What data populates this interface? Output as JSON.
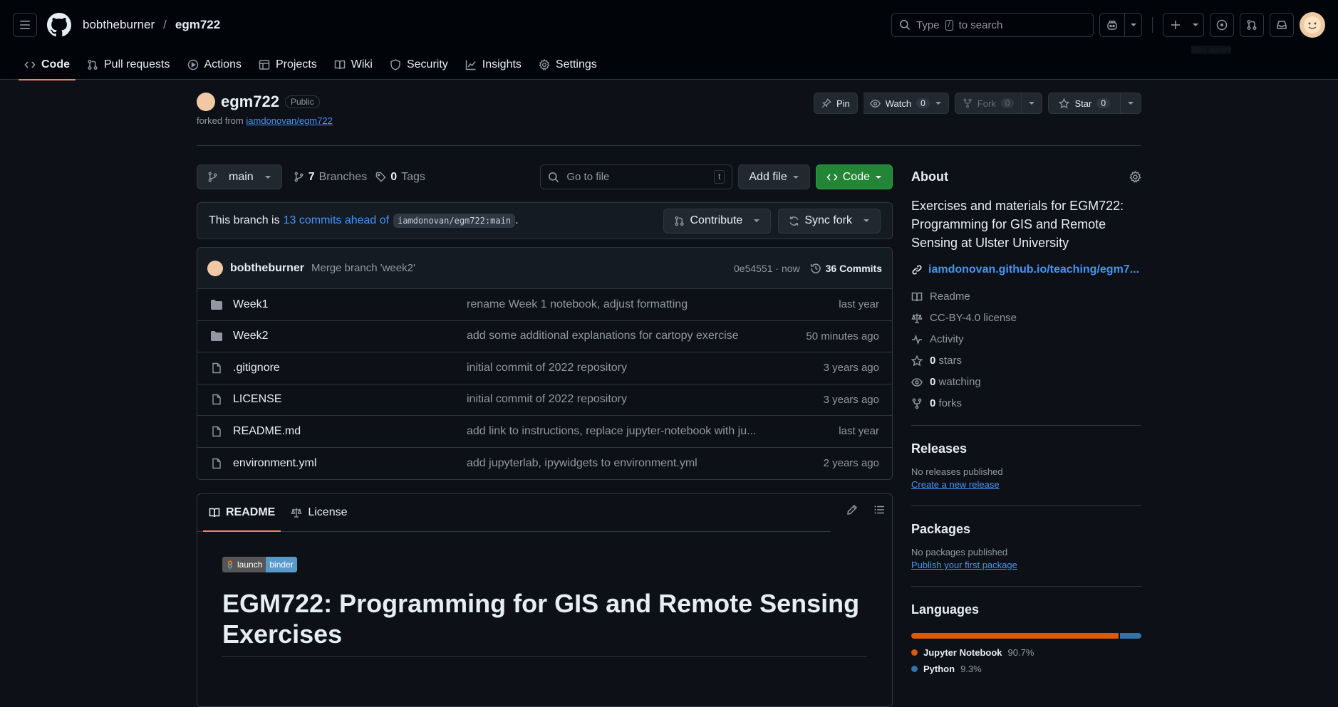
{
  "header": {
    "owner": "bobtheburner",
    "separator": "/",
    "repo": "egm722",
    "search_placeholder_prefix": "Type",
    "search_key": "/",
    "search_placeholder_suffix": "to search",
    "tooltip": "Your issues"
  },
  "nav_tabs": [
    {
      "label": "Code",
      "icon": "code-icon"
    },
    {
      "label": "Pull requests",
      "icon": "git-pull-request-icon"
    },
    {
      "label": "Actions",
      "icon": "play-icon"
    },
    {
      "label": "Projects",
      "icon": "table-icon"
    },
    {
      "label": "Wiki",
      "icon": "book-icon"
    },
    {
      "label": "Security",
      "icon": "shield-icon"
    },
    {
      "label": "Insights",
      "icon": "graph-icon"
    },
    {
      "label": "Settings",
      "icon": "gear-icon"
    }
  ],
  "repo_header": {
    "name": "egm722",
    "visibility": "Public",
    "forked_prefix": "forked from",
    "forked_from": "iamdonovan/egm722",
    "pin_label": "Pin",
    "watch_label": "Watch",
    "watch_count": "0",
    "fork_label": "Fork",
    "fork_count": "0",
    "star_label": "Star",
    "star_count": "0"
  },
  "toolbar": {
    "branch": "main",
    "branches_count": "7",
    "branches_label": "Branches",
    "tags_count": "0",
    "tags_label": "Tags",
    "goto_placeholder": "Go to file",
    "goto_key": "t",
    "add_file_label": "Add file",
    "code_label": "Code"
  },
  "ahead_banner": {
    "prefix": "This branch is",
    "link": "13 commits ahead of",
    "ref": "iamdonovan/egm722:main",
    "suffix": ".",
    "contribute_label": "Contribute",
    "sync_label": "Sync fork"
  },
  "latest_commit": {
    "author": "bobtheburner",
    "message": "Merge branch 'week2'",
    "hash_time": "0e54551 · now",
    "commits_label": "36 Commits"
  },
  "files": [
    {
      "type": "folder",
      "name": "Week1",
      "message": "rename Week 1 notebook, adjust formatting",
      "date": "last year"
    },
    {
      "type": "folder",
      "name": "Week2",
      "message": "add some additional explanations for cartopy exercise",
      "date": "50 minutes ago"
    },
    {
      "type": "file",
      "name": ".gitignore",
      "message": "initial commit of 2022 repository",
      "date": "3 years ago"
    },
    {
      "type": "file",
      "name": "LICENSE",
      "message": "initial commit of 2022 repository",
      "date": "3 years ago"
    },
    {
      "type": "file",
      "name": "README.md",
      "message": "add link to instructions, replace jupyter-notebook with ju...",
      "date": "last year"
    },
    {
      "type": "file",
      "name": "environment.yml",
      "message": "add jupyterlab, ipywidgets to environment.yml",
      "date": "2 years ago"
    }
  ],
  "readme": {
    "tab_readme": "README",
    "tab_license": "License",
    "binder_left": "launch",
    "binder_right": "binder",
    "title": "EGM722: Programming for GIS and Remote Sensing Exercises"
  },
  "about": {
    "heading": "About",
    "description": "Exercises and materials for EGM722: Programming for GIS and Remote Sensing at Ulster University",
    "homepage": "iamdonovan.github.io/teaching/egm7...",
    "readme": "Readme",
    "license": "CC-BY-4.0 license",
    "activity": "Activity",
    "stars_count": "0",
    "stars_label": "stars",
    "watching_count": "0",
    "watching_label": "watching",
    "forks_count": "0",
    "forks_label": "forks"
  },
  "releases": {
    "heading": "Releases",
    "none": "No releases published",
    "link": "Create a new release"
  },
  "packages": {
    "heading": "Packages",
    "none": "No packages published",
    "link": "Publish your first package"
  },
  "languages": {
    "heading": "Languages",
    "items": [
      {
        "name": "Jupyter Notebook",
        "pct": "90.7%",
        "value": 90.7,
        "color": "#DA5B0B"
      },
      {
        "name": "Python",
        "pct": "9.3%",
        "value": 9.3,
        "color": "#3572A5"
      }
    ]
  },
  "colors": {
    "accent": "#f78166",
    "link": "#4493f8",
    "green": "#238636"
  }
}
